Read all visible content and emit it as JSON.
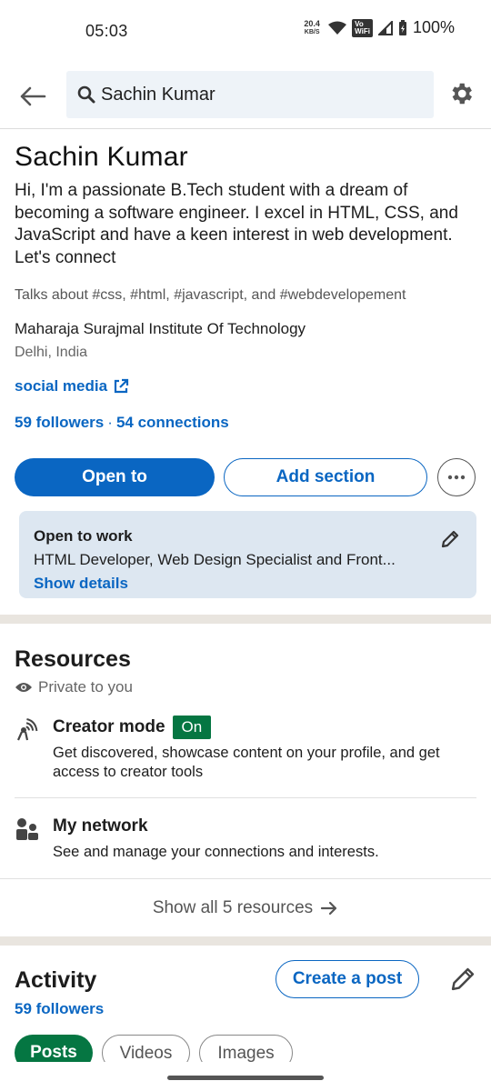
{
  "status_bar": {
    "time": "05:03",
    "net_speed_value": "20.4",
    "net_speed_unit": "KB/S",
    "vowifi_line1": "Vo",
    "vowifi_line2": "WiFi",
    "battery": "100%"
  },
  "header": {
    "search_text": "Sachin Kumar"
  },
  "profile": {
    "name": "Sachin Kumar",
    "headline": "Hi, I'm a passionate B.Tech student with a dream of becoming a software engineer. I excel in HTML, CSS, and JavaScript and have a keen interest in web development. Let's connect",
    "talks_about": "Talks about #css, #html, #javascript, and #webdevelopement",
    "organization": "Maharaja Surajmal Institute Of Technology",
    "location": "Delhi, India",
    "link_label": "social media",
    "followers": "59 followers",
    "connections": "54 connections",
    "separator": "·"
  },
  "actions": {
    "open_to": "Open to",
    "add_section": "Add section"
  },
  "open_to_work": {
    "title": "Open to work",
    "roles": "HTML Developer, Web Design Specialist and Front...",
    "show_details": "Show details"
  },
  "resources": {
    "title": "Resources",
    "privacy": "Private to you",
    "items": [
      {
        "title": "Creator mode",
        "badge": "On",
        "description": "Get discovered, showcase content on your profile, and get access to creator tools"
      },
      {
        "title": "My network",
        "description": "See and manage your connections and interests."
      }
    ],
    "show_all": "Show all 5 resources"
  },
  "activity": {
    "title": "Activity",
    "followers": "59 followers",
    "create_post": "Create a post",
    "tabs": [
      "Posts",
      "Videos",
      "Images"
    ]
  },
  "colors": {
    "accent": "#0a66c2",
    "green": "#057642",
    "card_bg": "#dde7f1",
    "section_sep": "#e9e5df"
  }
}
